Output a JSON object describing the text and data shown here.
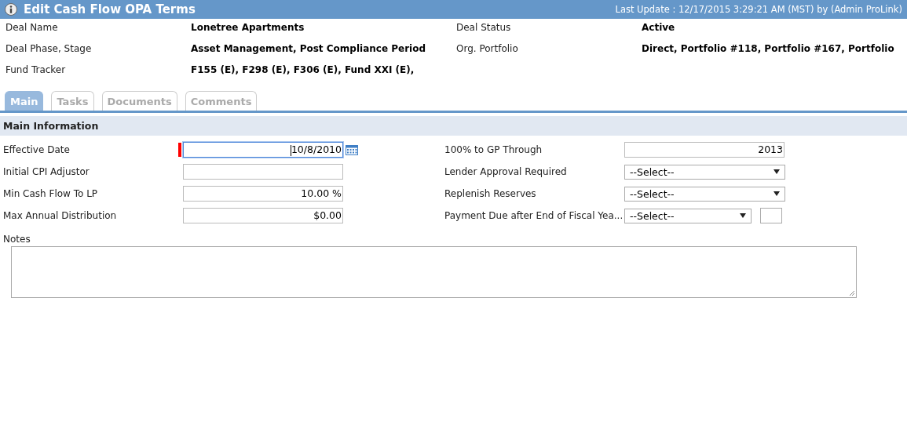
{
  "window": {
    "title": "Edit Cash Flow OPA Terms",
    "last_update": "Last Update : 12/17/2015 3:29:21 AM (MST) by (Admin ProLink)"
  },
  "deal_info": [
    {
      "label": "Deal Name",
      "value": "Lonetree Apartments"
    },
    {
      "label": "Deal Status",
      "value": "Active"
    },
    {
      "label": "Deal Phase, Stage",
      "value": "Asset Management, Post Compliance Period"
    },
    {
      "label": "Org. Portfolio",
      "value": "Direct, Portfolio #118, Portfolio #167, Portfolio"
    },
    {
      "label": "Fund Tracker",
      "value": "F155 (E), F298 (E), F306 (E), Fund XXI (E),"
    }
  ],
  "tabs": [
    {
      "label": "Main",
      "selected": true
    },
    {
      "label": "Tasks",
      "selected": false
    },
    {
      "label": "Documents",
      "selected": false
    },
    {
      "label": "Comments",
      "selected": false
    }
  ],
  "section": {
    "title": "Main Information"
  },
  "fields": [
    {
      "label": "Effective Date",
      "kind": "date",
      "value": "10/8/2010",
      "required": true,
      "focused": true
    },
    {
      "label": "100% to GP Through",
      "kind": "text",
      "value": "2013",
      "required": false,
      "focused": false
    },
    {
      "label": "Initial CPI Adjustor",
      "kind": "text",
      "required": false,
      "focused": false
    },
    {
      "label": "Lender Approval Required",
      "kind": "select",
      "value": "--Select--",
      "required": false,
      "focused": false
    },
    {
      "label": "Min Cash Flow To LP",
      "kind": "text",
      "value": "10.00 %",
      "required": false,
      "focused": false
    },
    {
      "label": "Replenish Reserves",
      "kind": "select",
      "value": "--Select--",
      "required": false,
      "focused": false
    },
    {
      "label": "Max Annual Distribution",
      "kind": "text",
      "value": "$0.00",
      "required": false,
      "focused": false
    },
    {
      "label": "Payment Due after End of Fiscal Yea...",
      "kind": "select_with_box",
      "value": "--Select--",
      "required": false,
      "focused": false
    }
  ],
  "notes": {
    "label": "Notes"
  }
}
